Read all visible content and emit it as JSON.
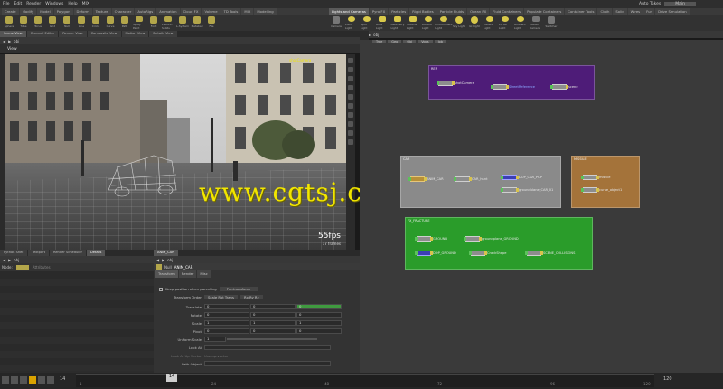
{
  "menubar": [
    "File",
    "Edit",
    "Render",
    "Windows",
    "Help",
    "MIX"
  ],
  "shelf_tabs_left": [
    "Create",
    "Modify",
    "Model",
    "Polygon",
    "Deform",
    "Texture",
    "Character",
    "AutoRigs",
    "Animation",
    "Cloud FX",
    "Volume",
    "TD Tools",
    "MIX",
    "Modelling"
  ],
  "shelf_tabs_right": [
    "Lights and Cameras",
    "Pyro FX",
    "Particles",
    "Rigid Bodies",
    "Particle Fluids",
    "Ocean FX",
    "Fluid Containers",
    "Populate Containers",
    "Container Tools",
    "Cloth",
    "Solid",
    "Wires",
    "Fur",
    "Drive Simulation"
  ],
  "desk": {
    "label": "Auto Takes",
    "value": "Main"
  },
  "left_tools": [
    "Sphere",
    "Tube",
    "Torus",
    "Grid",
    "Null",
    "Line",
    "Circle",
    "Curve",
    "Path",
    "Spray Paint",
    "Font",
    "Platonic Solids",
    "L-System",
    "Metaball",
    "File"
  ],
  "right_tools": [
    "Camera",
    "Point Light",
    "Spot Light",
    "Area Light",
    "Geometry Light",
    "Volume Light",
    "Distant Light",
    "Environment Light",
    "Sky Light",
    "GI Light",
    "Caustic Light",
    "Portal Light",
    "Ambient Light",
    "Stereo Camera",
    "Switcher"
  ],
  "view_tabs": [
    "Scene View",
    "Channel Editor",
    "Render View",
    "Composite View",
    "Motion View",
    "Details View"
  ],
  "net_tabs": [
    "/obj",
    "Tree View",
    "Material Palette",
    "Asset Browser"
  ],
  "path_obj": "obj",
  "viewport": {
    "title": "View",
    "persp": "",
    "fps": "55fps",
    "frames": "17 frames",
    "cam_label": "shotCamera",
    "watermark": "www.cgtsj.com"
  },
  "net_subtabs": [
    "Tree",
    "Geo",
    "Obj",
    "Vops",
    "Job"
  ],
  "net_groups": [
    {
      "label": "REF",
      "color": "#4e1c78",
      "nodes": [
        "shotCamera",
        "StreetReference",
        "scene"
      ]
    },
    {
      "label": "CAR",
      "color": "#8a8a8a",
      "nodes": [
        "ANIM_CAR",
        "CAR_hunt",
        "DOP_CAR_POP",
        "groundplane_CAR_01"
      ]
    },
    {
      "label": "MISSILE",
      "color": "#a4733a",
      "nodes": [
        "missile",
        "curve_object1"
      ]
    },
    {
      "label": "FX_FRACTURE",
      "color": "#2a9c2a",
      "nodes": [
        "GROUND",
        "groundplane_GROUND",
        "DOP_GROUND",
        "CrackShape",
        "SCENE_COLLISIONS"
      ]
    }
  ],
  "bottom_tabs": [
    "Python Shell",
    "Textport",
    "Render Scheduler",
    "Details",
    "ANIM_CAR"
  ],
  "param_tabs_top": [
    "ANIM_CAR"
  ],
  "node_list": {
    "label": "Node:",
    "filter": "Attributes"
  },
  "params": {
    "node_type": "Null",
    "node_name": "ANIM_CAR",
    "tabs": [
      "Transform",
      "Render",
      "Misc"
    ],
    "keep_position": "Keep position when parenting",
    "keep_position_value": "Pre-transform",
    "transform_order_label": "Transform Order",
    "transform_order": "Scale Rot Trans",
    "rot_order": "Rx Ry Rz",
    "rows": [
      {
        "label": "Translate",
        "values": [
          "0",
          "0",
          "0"
        ]
      },
      {
        "label": "Rotate",
        "values": [
          "0",
          "0",
          "0"
        ]
      },
      {
        "label": "Scale",
        "values": [
          "1",
          "1",
          "1"
        ]
      },
      {
        "label": "Pivot",
        "values": [
          "0",
          "0",
          "0"
        ]
      },
      {
        "label": "Uniform Scale",
        "values": [
          "1"
        ]
      }
    ],
    "look_at": "Look At",
    "look_up": "Look At Up Vector",
    "look_up_value": "Use up-vector",
    "path_object": "Path Object"
  },
  "timeline": {
    "current_frame": "14",
    "start": "1",
    "end": "120",
    "ticks": [
      "14",
      "24",
      "48",
      "72",
      "96",
      "120"
    ]
  },
  "colors": {
    "accent": "#f2e600",
    "green_field": "#3f9a3f"
  }
}
